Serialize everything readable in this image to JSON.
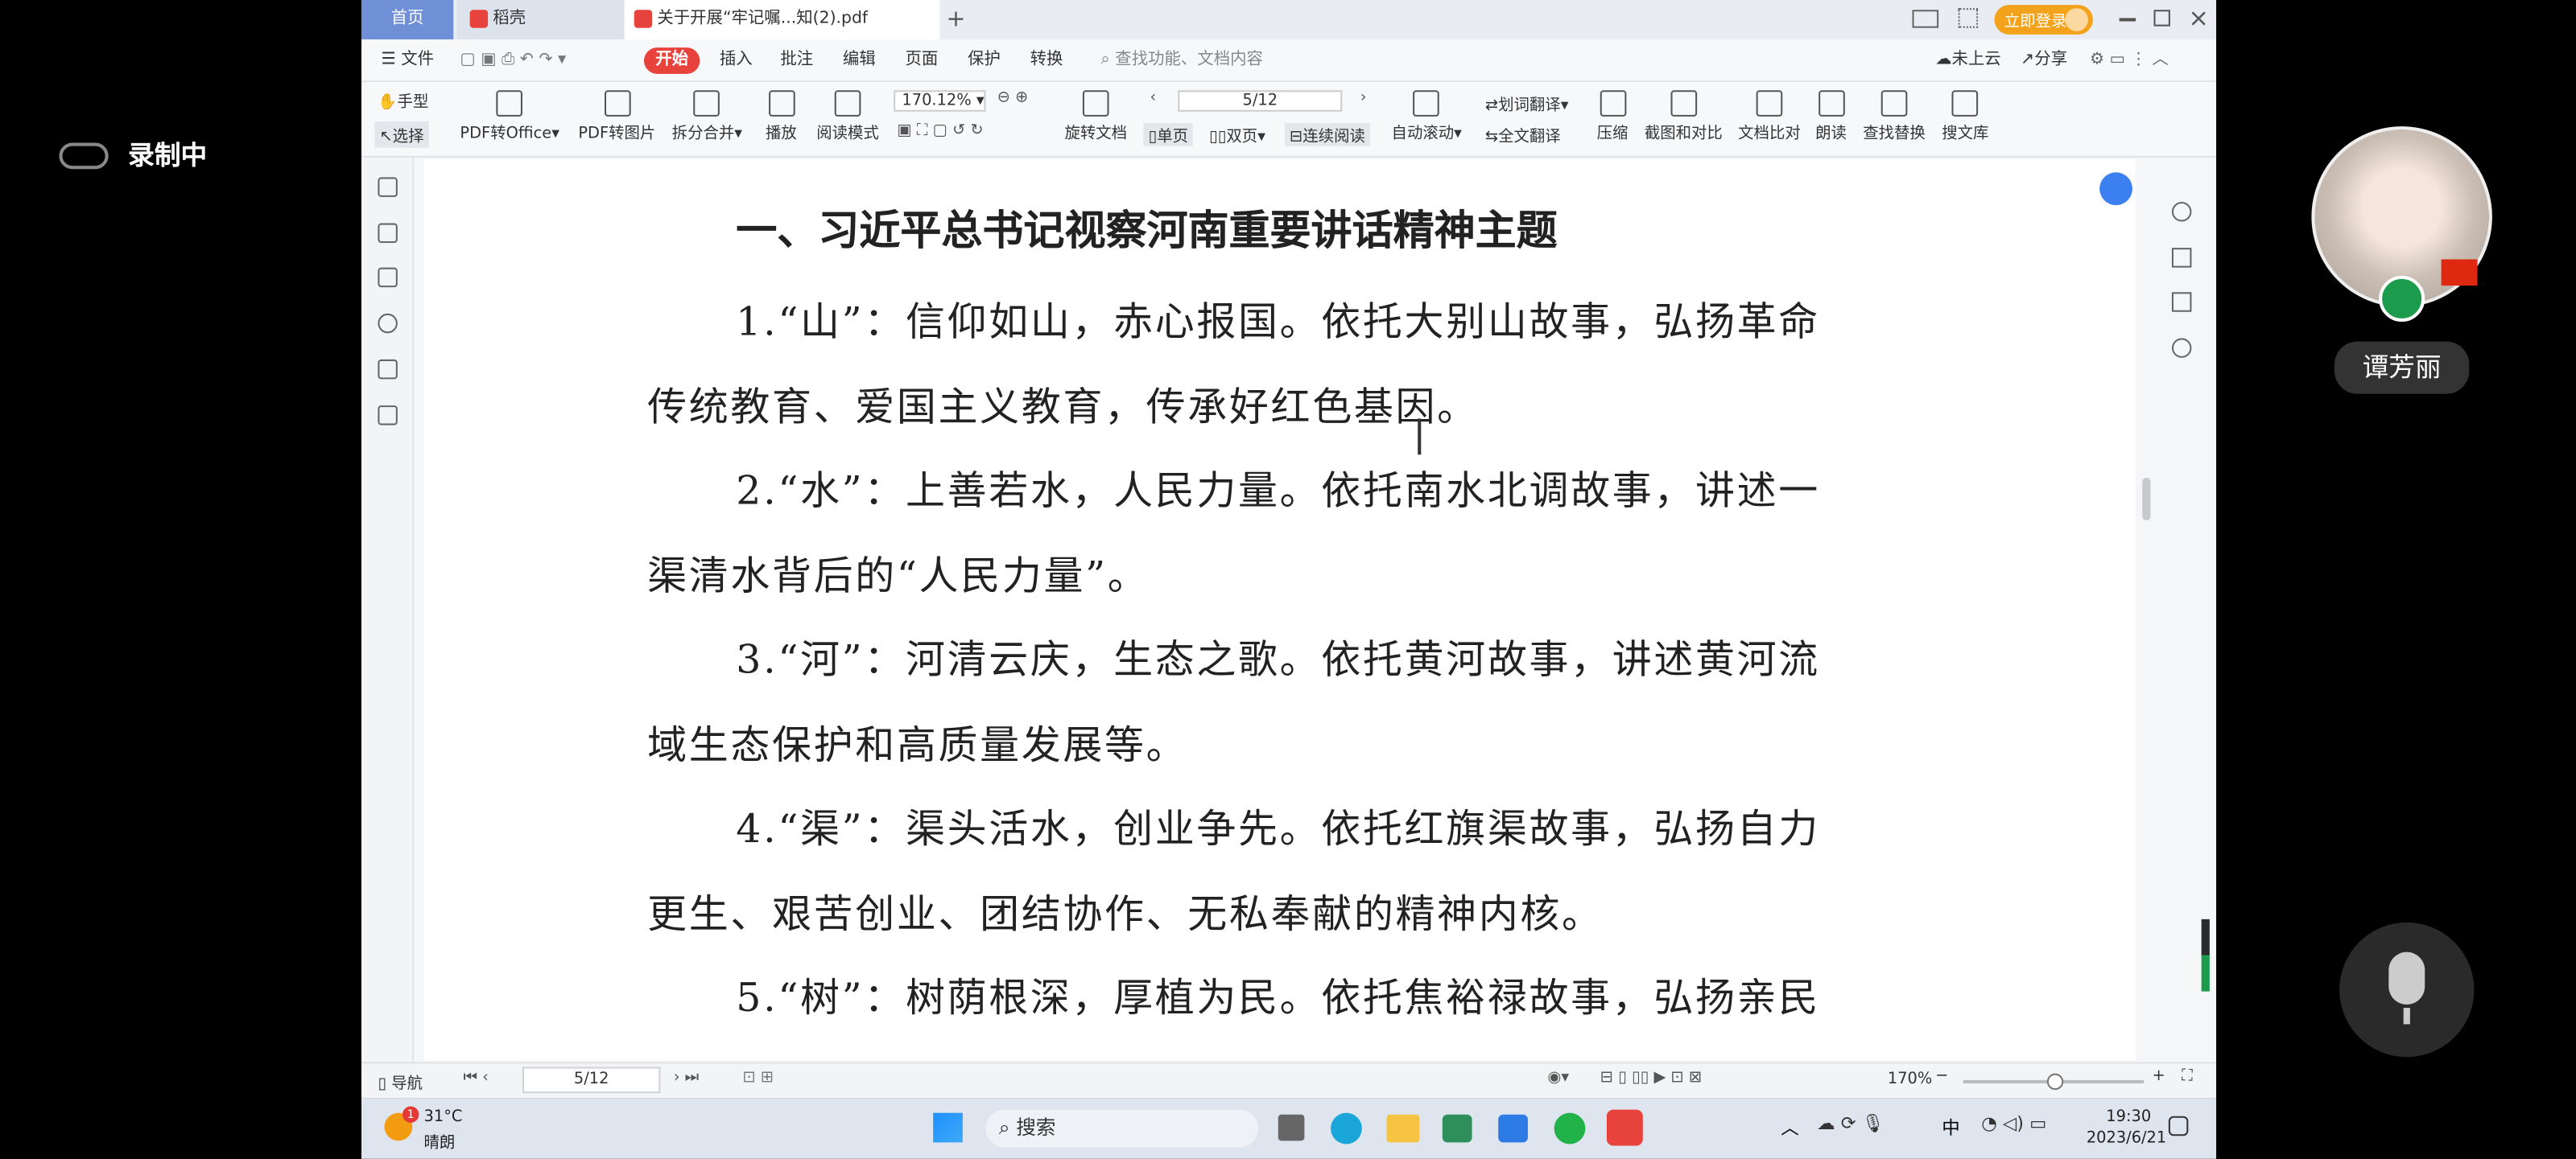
{
  "recording": {
    "label": "录制中"
  },
  "tabs": {
    "home": "首页",
    "docer": "稻壳",
    "file": "关于开展“牢记嘱...知(2).pdf",
    "new_tab": "+"
  },
  "titlebar": {
    "login": "立即登录"
  },
  "menu": {
    "file": "文件",
    "start": "开始",
    "insert": "插入",
    "comment": "批注",
    "edit": "编辑",
    "page": "页面",
    "protect": "保护",
    "convert": "转换",
    "search_placeholder": "查找功能、文档内容",
    "cloud": "未上云",
    "share": "分享"
  },
  "toolbar": {
    "hand": "手型",
    "select": "选择",
    "pdf_office": "PDF转Office",
    "pdf_image": "PDF转图片",
    "split_merge": "拆分合并",
    "play": "播放",
    "read_mode": "阅读模式",
    "zoom": "170.12%",
    "page_input": "5/12",
    "rotate": "旋转文档",
    "single": "单页",
    "double": "双页",
    "continuous": "连续阅读",
    "auto_scroll": "自动滚动",
    "word_translate": "划词翻译",
    "full_translate": "全文翻译",
    "compress": "压缩",
    "screenshot": "截图和对比",
    "compare": "文档比对",
    "read_aloud": "朗读",
    "find_replace": "查找替换",
    "search_lib": "搜文库"
  },
  "document": {
    "heading": "一、习近平总书记视察河南重要讲话精神主题",
    "lines": [
      "1.“山”：信仰如山，赤心报国。依托大别山故事，弘扬革命",
      "传统教育、爱国主义教育，传承好红色基因。",
      "2.“水”：上善若水，人民力量。依托南水北调故事，讲述一",
      "渠清水背后的“人民力量”。",
      "3.“河”：河清云庆，生态之歌。依托黄河故事，讲述黄河流",
      "域生态保护和高质量发展等。",
      "4.“渠”：渠头活水，创业争先。依托红旗渠故事，弘扬自力",
      "更生、艰苦创业、团结协作、无私奉献的精神内核。",
      "5.“树”：树荫根深，厚植为民。依托焦裕禄故事，弘扬亲民"
    ]
  },
  "status": {
    "nav": "导航",
    "page": "5/12",
    "zoom": "170%"
  },
  "taskbar": {
    "temp": "31°C",
    "weather": "晴朗",
    "search": "搜索",
    "time": "19:30",
    "date": "2023/6/21",
    "ime": "中",
    "badge": "1"
  },
  "participant": {
    "name": "谭芳丽"
  }
}
